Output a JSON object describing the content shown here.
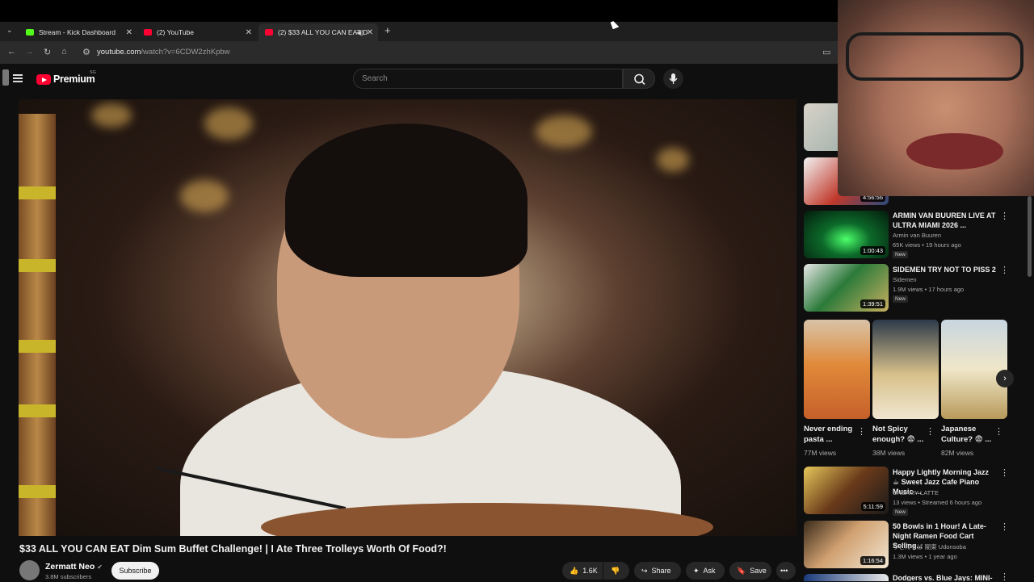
{
  "browser": {
    "tabs": [
      {
        "title": "Stream - Kick Dashboard",
        "favicon_color": "#53fc18"
      },
      {
        "title": "(2) YouTube",
        "favicon_color": "#ff0033"
      },
      {
        "title": "(2) $33 ALL YOU CAN EAT D",
        "favicon_color": "#ff0033"
      }
    ],
    "new_tab": "+",
    "url_domain": "youtube.com",
    "url_path": "/watch?v=6CDW2zhKpbw"
  },
  "youtube": {
    "logo_text": "Premium",
    "logo_sup": "SG",
    "search_placeholder": "Search"
  },
  "video": {
    "title": "$33 ALL YOU CAN EAT Dim Sum Buffet Challenge! | I Ate Three Trolleys Worth Of Food?!",
    "channel": "Zermatt Neo",
    "subscribers": "3.8M subscribers",
    "subscribe_label": "Subscribe",
    "likes": "1.6K",
    "share_label": "Share",
    "ask_label": "Ask",
    "save_label": "Save"
  },
  "related": [
    {
      "title": "ARMIN VAN BUUREN LIVE AT ULTRA MIAMI 2026 ...",
      "channel": "Armin van Buuren",
      "meta": "65K views • 19 hours ago",
      "badge": "New",
      "duration": "1:00:43"
    },
    {
      "title": "SIDEMEN TRY NOT TO PISS 2",
      "channel": "Sidemen",
      "meta": "1.9M views • 17 hours ago",
      "badge": "New",
      "duration": "1:39:51"
    },
    {
      "title": "Happy Lightly Morning Jazz ☕ Sweet Jazz Cafe Piano Music ...",
      "channel": "CREAMY LATTE",
      "meta": "13 views • Streamed 6 hours ago",
      "badge": "New",
      "duration": "5:11:59"
    },
    {
      "title": "50 Bowls in 1 Hour! A Late-Night Ramen Food Cart Selling...",
      "channel": "うどんそば 闇東 Udonsoba",
      "meta": "1.3M views • 1 year ago",
      "badge": "",
      "duration": "1:16:54"
    },
    {
      "title": "Dodgers vs. Blue Jays: MINI-",
      "channel": "",
      "meta": "",
      "badge": "",
      "duration": ""
    }
  ],
  "top_thumb_duration": "4:56:56",
  "shorts": [
    {
      "title": "Never ending pasta ...",
      "views": "77M views"
    },
    {
      "title": "Not Spicy enough? 😨 ...",
      "views": "38M views"
    },
    {
      "title": "Japanese Culture? 😨 ...",
      "views": "82M views"
    }
  ]
}
